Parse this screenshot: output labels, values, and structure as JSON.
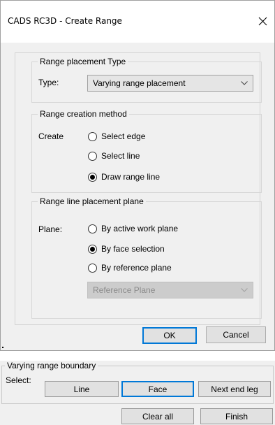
{
  "dialog": {
    "title": "CADS RC3D - Create Range",
    "close_icon": "close-icon",
    "placement_type": {
      "legend": "Range placement Type",
      "type_label": "Type:",
      "type_value": "Varying range placement"
    },
    "creation_method": {
      "legend": "Range creation method",
      "create_label": "Create",
      "options": [
        {
          "label": "Select edge",
          "selected": false
        },
        {
          "label": "Select line",
          "selected": false
        },
        {
          "label": "Draw range line",
          "selected": true
        }
      ]
    },
    "placement_plane": {
      "legend": "Range line placement plane",
      "plane_label": "Plane:",
      "options": [
        {
          "label": "By active work plane",
          "selected": false
        },
        {
          "label": "By face selection",
          "selected": true
        },
        {
          "label": "By reference plane",
          "selected": false
        }
      ],
      "reference_plane_value": "Reference Plane"
    },
    "ok_label": "OK",
    "cancel_label": "Cancel"
  },
  "boundary_panel": {
    "legend": "Varying range boundary",
    "select_label": "Select:",
    "line_label": "Line",
    "face_label": "Face",
    "next_end_leg_label": "Next end leg",
    "clear_all_label": "Clear all",
    "finish_label": "Finish"
  },
  "icons": {
    "close": "close-icon",
    "chevron": "chevron-down-icon"
  }
}
